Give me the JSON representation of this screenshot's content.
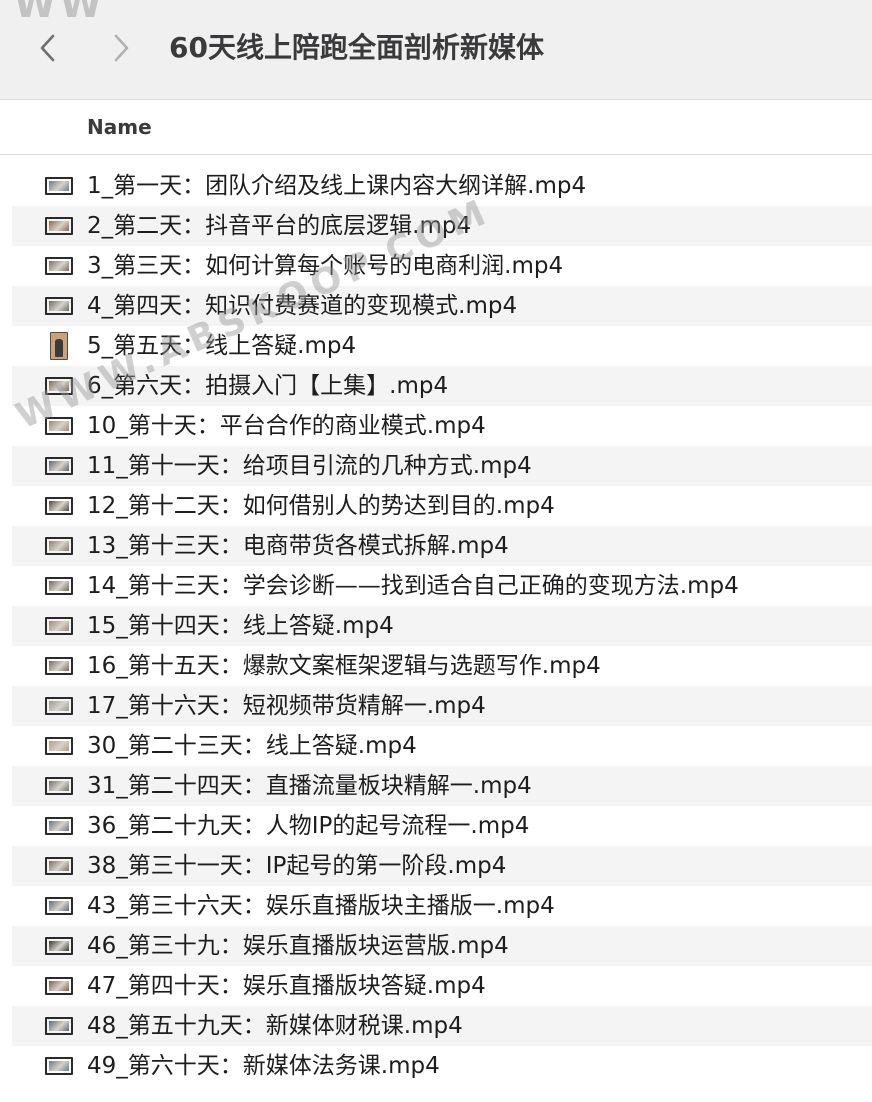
{
  "window": {
    "title": "60天线上陪跑全面剖析新媒体"
  },
  "watermarks": {
    "top": "WW",
    "diagonal": "WWW.ABSKOOP.COM"
  },
  "header": {
    "column_name": "Name"
  },
  "files": [
    {
      "name": "1_第一天：团队介绍及线上课内容大纲详解.mp4",
      "thumb": "#6b7b8c"
    },
    {
      "name": "2_第二天：抖音平台的底层逻辑.mp4",
      "thumb": "#8a6a4a"
    },
    {
      "name": "3_第三天：如何计算每个账号的电商利润.mp4",
      "thumb": "#7a7060"
    },
    {
      "name": "4_第四天：知识付费赛道的变现模式.mp4",
      "thumb": "#6a6a6a"
    },
    {
      "name": "5_第五天：线上答疑.mp4",
      "thumb": "#c9a27a",
      "portrait": true
    },
    {
      "name": "6_第六天：拍摄入门【上集】.mp4",
      "thumb": "#7c6b55"
    },
    {
      "name": "10_第十天：平台合作的商业模式.mp4",
      "thumb": "#9a8b70"
    },
    {
      "name": "11_第十一天：给项目引流的几种方式.mp4",
      "thumb": "#5e6670"
    },
    {
      "name": "12_第十二天：如何借别人的势达到目的.mp4",
      "thumb": "#4f4a44"
    },
    {
      "name": "13_第十三天：电商带货各模式拆解.mp4",
      "thumb": "#8c7f6c"
    },
    {
      "name": "14_第十三天：学会诊断——找到适合自己正确的变现方法.mp4",
      "thumb": "#6f6a63"
    },
    {
      "name": "15_第十四天：线上答疑.mp4",
      "thumb": "#a08a70"
    },
    {
      "name": "16_第十五天：爆款文案框架逻辑与选题写作.mp4",
      "thumb": "#77695a"
    },
    {
      "name": "17_第十六天：短视频带货精解一.mp4",
      "thumb": "#9a9a9a"
    },
    {
      "name": "30_第二十三天：线上答疑.mp4",
      "thumb": "#b89b7c"
    },
    {
      "name": "31_第二十四天：直播流量板块精解一.mp4",
      "thumb": "#707070"
    },
    {
      "name": "36_第二十九天：人物IP的起号流程一.mp4",
      "thumb": "#6a7484"
    },
    {
      "name": "38_第三十一天：IP起号的第一阶段.mp4",
      "thumb": "#7d6e5e"
    },
    {
      "name": "43_第三十六天：娱乐直播版块主播版一.mp4",
      "thumb": "#5d6a7a"
    },
    {
      "name": "46_第三十九：娱乐直播版块运营版.mp4",
      "thumb": "#3a3a3a"
    },
    {
      "name": "47_第四十天：娱乐直播版块答疑.mp4",
      "thumb": "#8a5a4a"
    },
    {
      "name": "48_第五十九天：新媒体财税课.mp4",
      "thumb": "#5a6a7a"
    },
    {
      "name": "49_第六十天：新媒体法务课.mp4",
      "thumb": "#6a7a8a"
    }
  ]
}
